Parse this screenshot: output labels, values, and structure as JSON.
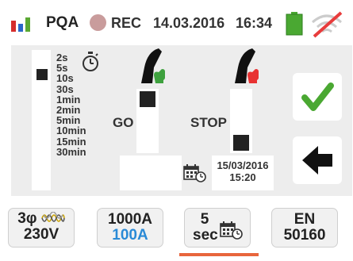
{
  "status_bar": {
    "app_name": "PQA",
    "rec_label": "REC",
    "date": "14.03.2016",
    "time": "16:34",
    "icons": [
      "app-bars-icon",
      "rec-dot-icon",
      "battery-icon",
      "wifi-off-icon"
    ],
    "colors": {
      "app_red": "#d62d2d",
      "app_blue": "#2a67c9",
      "app_green": "#5aa832",
      "battery": "#4aa832",
      "no_signal": "#e83c3c"
    }
  },
  "interval": {
    "options": [
      "2s",
      "5s",
      "10s",
      "30s",
      "1min",
      "2min",
      "5min",
      "10min",
      "15min",
      "30min"
    ],
    "selected": "5s"
  },
  "go": {
    "label": "GO"
  },
  "stop": {
    "label": "STOP",
    "date": "15/03/2016",
    "time": "15:20"
  },
  "actions": {
    "confirm": "checkmark-icon",
    "back": "arrow-left-icon",
    "confirm_color": "#4aa832"
  },
  "tabs": [
    {
      "id": "system",
      "line1": "3φ",
      "line2": "230V",
      "icon": "three-phase-coil-icon"
    },
    {
      "id": "current",
      "line1": "1000A",
      "line2": "100A",
      "line2_color": "#2a8ad6"
    },
    {
      "id": "interval",
      "line1": "5",
      "line2": "sec",
      "icon": "calendar-clock-icon",
      "active": true
    },
    {
      "id": "standard",
      "line1": "EN",
      "line2": "50160"
    }
  ],
  "accent": "#e8653c"
}
